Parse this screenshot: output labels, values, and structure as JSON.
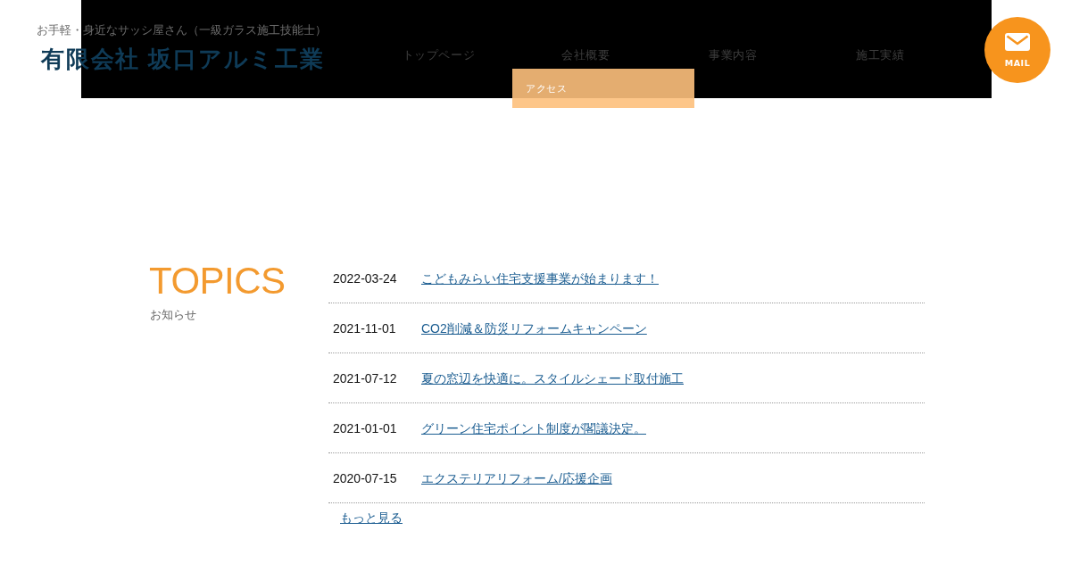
{
  "header": {
    "tagline": "お手軽・身近なサッシ屋さん（一級ガラス施工技能士）",
    "logo": "有限会社 坂口アルミ工業",
    "nav": [
      {
        "label": "トップページ"
      },
      {
        "label": "会社概要",
        "submenu": [
          {
            "label": "アクセス"
          }
        ]
      },
      {
        "label": "事業内容"
      },
      {
        "label": "施工実績"
      }
    ],
    "mail_button": {
      "label": "MAIL"
    }
  },
  "topics": {
    "title": "TOPICS",
    "subtitle": "お知らせ",
    "items": [
      {
        "date": "2022-03-24",
        "title": "こどもみらい住宅支援事業が始まります！"
      },
      {
        "date": "2021-11-01",
        "title": "CO2削減＆防災リフォームキャンペーン"
      },
      {
        "date": "2021-07-12",
        "title": "夏の窓辺を快適に。スタイルシェード取付施工"
      },
      {
        "date": "2021-01-01",
        "title": "グリーン住宅ポイント制度が閣議決定。"
      },
      {
        "date": "2020-07-15",
        "title": "エクステリアリフォーム/応援企画"
      }
    ],
    "more_link": "もっと見る"
  }
}
